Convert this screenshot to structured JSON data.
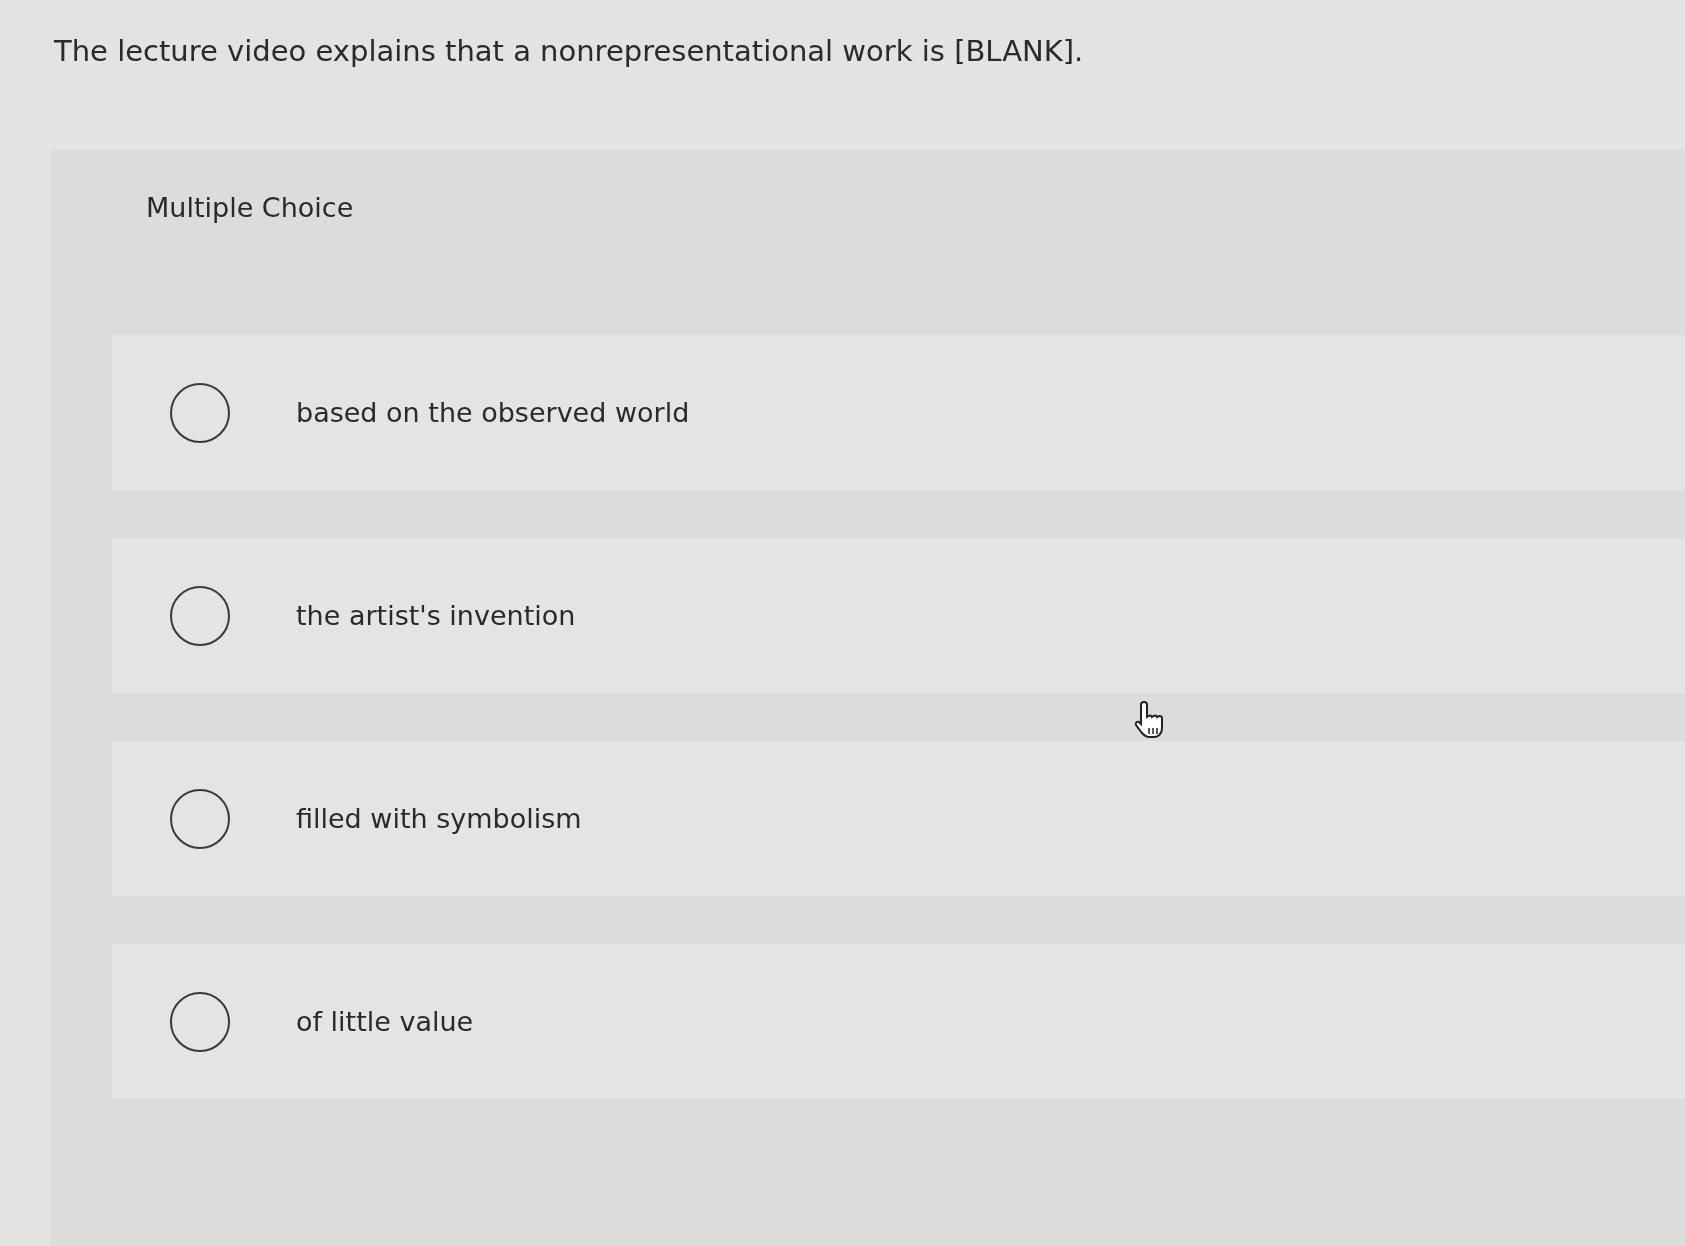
{
  "question": "The lecture video explains that a nonrepresentational work is [BLANK].",
  "section_label": "Multiple Choice",
  "options": [
    {
      "label": "based on the observed world",
      "selected": false
    },
    {
      "label": "the artist's invention",
      "selected": false
    },
    {
      "label": "filled with symbolism",
      "selected": false
    },
    {
      "label": "of little value",
      "selected": false
    }
  ]
}
